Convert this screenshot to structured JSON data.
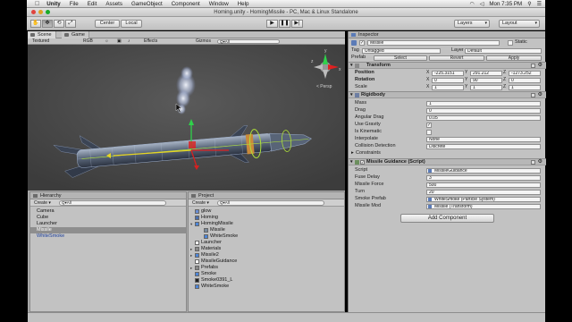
{
  "menubar": {
    "apple": "",
    "app": "Unity",
    "items": [
      "File",
      "Edit",
      "Assets",
      "GameObject",
      "Component",
      "Window",
      "Help"
    ],
    "clock": "Mon 7:35 PM"
  },
  "window_title": "Homing.unity - HomingMissile - PC, Mac & Linux Standalone",
  "toolbar": {
    "tools": [
      "✋",
      "✥",
      "⟲",
      "⤢"
    ],
    "pivot_center": "Center",
    "pivot_local": "Local",
    "play_glyphs": [
      "▶",
      "❚❚",
      "▶|"
    ],
    "layers_label": "Layers",
    "layout_label": "Layout"
  },
  "scene_tabs": {
    "scene": "Scene",
    "game": "Game"
  },
  "scene_bar": {
    "render_mode": "Textured",
    "color_mode": "RGB",
    "effects": "Effects",
    "gizmos": "Gizmos",
    "search_prefix": "Q▾All"
  },
  "scene_view": {
    "persp_label": "< Persp",
    "gizmo_axes": [
      "x",
      "y",
      "z"
    ]
  },
  "hierarchy": {
    "title": "Hierarchy",
    "create": "Create ▾",
    "search_prefix": "Q▾All",
    "items": [
      {
        "label": "Camera",
        "state": "normal"
      },
      {
        "label": "Cube",
        "state": "normal"
      },
      {
        "label": "Launcher",
        "state": "normal"
      },
      {
        "label": "Missile",
        "state": "selected"
      },
      {
        "label": "WhiteSmoke",
        "state": "blue"
      }
    ]
  },
  "project": {
    "title": "Project",
    "create": "Create ▾",
    "search_prefix": "Q▾All",
    "items": [
      {
        "label": "glow",
        "indent": 0,
        "icon": "material-icon",
        "arrow": ""
      },
      {
        "label": "Homing",
        "indent": 0,
        "icon": "scene-icon",
        "arrow": ""
      },
      {
        "label": "HomingMissile",
        "indent": 0,
        "icon": "prefab-icon",
        "arrow": "▾"
      },
      {
        "label": "Missile",
        "indent": 1,
        "icon": "mesh-icon",
        "arrow": ""
      },
      {
        "label": "WhiteSmoke",
        "indent": 1,
        "icon": "prefab-icon",
        "arrow": ""
      },
      {
        "label": "Launcher",
        "indent": 0,
        "icon": "script-icon",
        "arrow": ""
      },
      {
        "label": "Materials",
        "indent": 0,
        "icon": "folder-icon",
        "arrow": "▸"
      },
      {
        "label": "Missile2",
        "indent": 0,
        "icon": "prefab-icon",
        "arrow": "▸"
      },
      {
        "label": "MissileGuidance",
        "indent": 0,
        "icon": "script-icon",
        "arrow": ""
      },
      {
        "label": "Prefabs",
        "indent": 0,
        "icon": "folder-icon",
        "arrow": "▸"
      },
      {
        "label": "Smoke",
        "indent": 0,
        "icon": "prefab-icon",
        "arrow": ""
      },
      {
        "label": "Smoke0391_L",
        "indent": 0,
        "icon": "texture-icon",
        "arrow": ""
      },
      {
        "label": "WhiteSmoke",
        "indent": 0,
        "icon": "prefab-icon",
        "arrow": ""
      }
    ]
  },
  "inspector": {
    "title": "Inspector",
    "object_name": "Missile",
    "static_label": "Static",
    "tag_label": "Tag",
    "tag_value": "Untagged",
    "layer_label": "Layer",
    "layer_value": "Default",
    "prefab_label": "Prefab",
    "prefab_buttons": [
      "Select",
      "Revert",
      "Apply"
    ],
    "transform": {
      "title": "Transform",
      "rows": [
        {
          "label": "Position",
          "x": "-225.3151",
          "y": "291.212",
          "z": "-1273.252"
        },
        {
          "label": "Rotation",
          "x": "0",
          "y": "90",
          "z": "0"
        },
        {
          "label": "Scale",
          "x": "1",
          "y": "1",
          "z": "1"
        }
      ]
    },
    "rigidbody": {
      "title": "Rigidbody",
      "rows": [
        {
          "label": "Mass",
          "value": "1",
          "kind": "field"
        },
        {
          "label": "Drag",
          "value": "0",
          "kind": "field"
        },
        {
          "label": "Angular Drag",
          "value": "0.05",
          "kind": "field"
        },
        {
          "label": "Use Gravity",
          "value": "✓",
          "kind": "check"
        },
        {
          "label": "Is Kinematic",
          "value": "",
          "kind": "check"
        },
        {
          "label": "Interpolate",
          "value": "None",
          "kind": "drop"
        },
        {
          "label": "Collision Detection",
          "value": "Discrete",
          "kind": "drop"
        }
      ],
      "constraints": "Constraints"
    },
    "guidance": {
      "title": "Missile Guidance (Script)",
      "rows": [
        {
          "label": "Script",
          "value": "MissileGuidance",
          "kind": "ref"
        },
        {
          "label": "Fuse Delay",
          "value": "3",
          "kind": "field"
        },
        {
          "label": "Missile Force",
          "value": "500",
          "kind": "field"
        },
        {
          "label": "Turn",
          "value": "20",
          "kind": "field"
        },
        {
          "label": "Smoke Prefab",
          "value": "WhiteSmoke (Particle System)",
          "kind": "ref"
        },
        {
          "label": "Missile Mod",
          "value": "Missile (Transform)",
          "kind": "ref"
        }
      ]
    },
    "add_component": "Add Component"
  },
  "colors": {
    "accent": "#3a6fd8",
    "selection": "#8e8e8e",
    "scene_bg": "#4b4b4b"
  }
}
